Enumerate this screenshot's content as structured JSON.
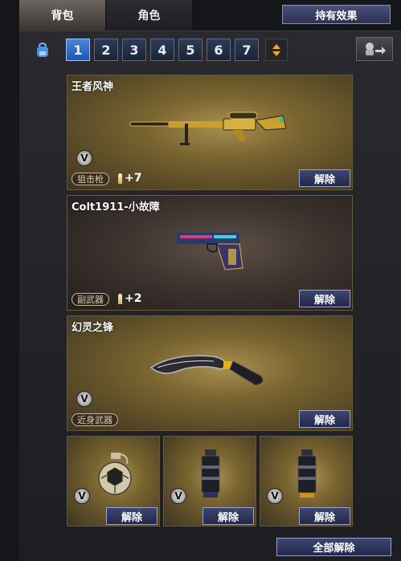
{
  "tabs": [
    {
      "label": "背包",
      "active": true
    },
    {
      "label": "角色",
      "active": false
    }
  ],
  "effect_button": "持有效果",
  "pages": [
    "1",
    "2",
    "3",
    "4",
    "5",
    "6",
    "7"
  ],
  "active_page": "1",
  "items": [
    {
      "name": "王者风神",
      "type": "狙击枪",
      "upgrade": "+7",
      "badge": "V",
      "unequip": "解除",
      "weapon_icon": "sniper-rifle-icon"
    },
    {
      "name": "Colt1911-小故障",
      "type": "副武器",
      "upgrade": "+2",
      "badge": "",
      "unequip": "解除",
      "weapon_icon": "pistol-icon"
    },
    {
      "name": "幻灵之锋",
      "type": "近身武器",
      "upgrade": "",
      "badge": "V",
      "unequip": "解除",
      "weapon_icon": "machete-icon"
    }
  ],
  "throwables": [
    {
      "badge": "V",
      "unequip": "解除",
      "icon": "frag-grenade-icon"
    },
    {
      "badge": "V",
      "unequip": "解除",
      "icon": "flashbang-icon"
    },
    {
      "badge": "V",
      "unequip": "解除",
      "icon": "smoke-grenade-icon"
    }
  ],
  "unequip_all": "全部解除",
  "colors": {
    "gold_card": "#7a6530",
    "brown_card": "#3e3430",
    "button": "#2d3152",
    "active_page": "#2f6ec8"
  }
}
